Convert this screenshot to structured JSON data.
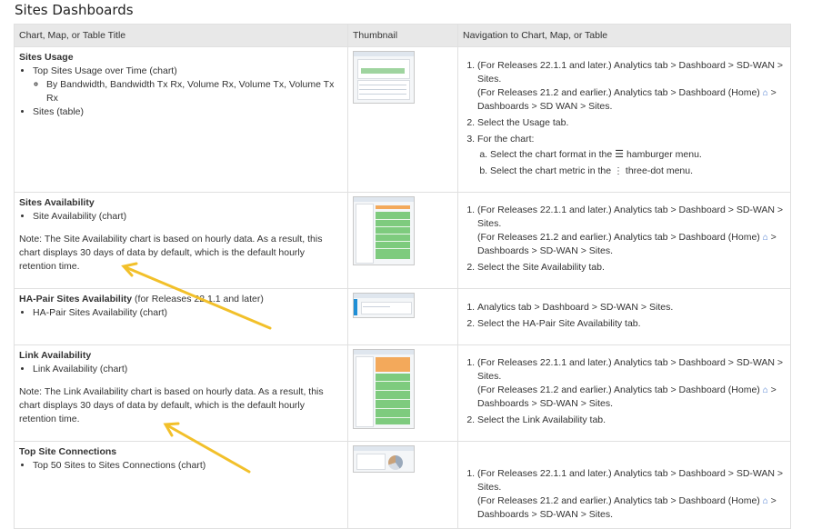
{
  "page": {
    "heading": "Sites Dashboards"
  },
  "table": {
    "headers": [
      "Chart, Map, or Table Title",
      "Thumbnail",
      "Navigation to Chart, Map, or Table"
    ],
    "rows": [
      {
        "title": "Sites Usage",
        "bullets": [
          "Top Sites Usage over Time (chart)",
          "Sites (table)"
        ],
        "sub_bullets": [
          "By Bandwidth, Bandwidth Tx Rx, Volume Rx, Volume Tx, Volume Tx Rx"
        ],
        "nav": {
          "step1_a": "(For Releases 22.1.1 and later.) Analytics tab > Dashboard > SD-WAN > Sites.",
          "step1_b": "(For Releases 21.2 and earlier.) Analytics tab > Dashboard (Home)",
          "step1_c": "> Dashboards > SD WAN > Sites.",
          "step2": "Select the Usage tab.",
          "step3": "For the chart:",
          "step3a_pre": "Select the chart format in the",
          "step3a_post": "hamburger menu.",
          "step3b_pre": "Select the chart metric in the",
          "step3b_post": "three-dot menu."
        }
      },
      {
        "title": "Sites Availability",
        "bullets": [
          "Site Availability (chart)"
        ],
        "note": "Note: The Site Availability chart is based on hourly data. As a result, this chart displays 30 days of data by default, which is the default hourly retention time.",
        "nav": {
          "step1_a": "(For Releases 22.1.1 and later.) Analytics tab > Dashboard > SD-WAN > Sites.",
          "step1_b": "(For Releases 21.2 and earlier.) Analytics tab > Dashboard (Home)",
          "step1_c": "> Dashboards > SD-WAN > Sites.",
          "step2": "Select the Site Availability tab."
        }
      },
      {
        "title": "HA-Pair Sites Availability",
        "title_suffix": " (for Releases 22.1.1 and later)",
        "bullets": [
          "HA-Pair Sites Availability (chart)"
        ],
        "nav": {
          "step1": "Analytics tab > Dashboard > SD-WAN > Sites.",
          "step2": "Select the HA-Pair Site Availability tab."
        }
      },
      {
        "title": "Link Availability",
        "bullets": [
          "Link Availability (chart)"
        ],
        "note": "Note: The Link Availability chart is based on hourly data. As a result, this chart displays 30 days of data by default, which is the default hourly retention time.",
        "nav": {
          "step1_a": "(For Releases 22.1.1 and later.) Analytics tab > Dashboard > SD-WAN > Sites.",
          "step1_b": "(For Releases 21.2 and earlier.) Analytics tab > Dashboard (Home)",
          "step1_c": "> Dashboards > SD-WAN > Sites.",
          "step2": "Select the Link Availability tab."
        }
      },
      {
        "title": "Top Site Connections",
        "bullets": [
          "Top 50 Sites to Sites Connections (chart)"
        ],
        "nav": {
          "step1_a": "(For Releases 22.1.1 and later.) Analytics tab > Dashboard > SD-WAN > Sites.",
          "step1_b": "(For Releases 21.2 and earlier.) Analytics tab > Dashboard (Home)",
          "step1_c": "> Dashboards > SD-WAN > Sites."
        }
      }
    ]
  },
  "icons": {
    "home": "home-icon",
    "hamburger": "hamburger-icon",
    "three_dot": "three-dot-icon"
  },
  "colors": {
    "arrow": "#f2c02a",
    "header_bg": "#e8e8e8",
    "home_icon": "#4a7bd0"
  }
}
